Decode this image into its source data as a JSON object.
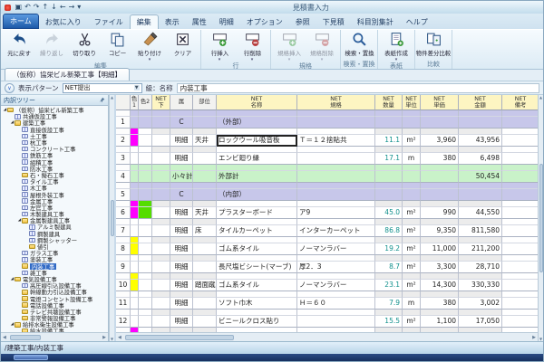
{
  "window": {
    "title": "見積書入力"
  },
  "quick_access": [
    "save",
    "undo",
    "redo",
    "up",
    "down",
    "left",
    "right",
    "menu"
  ],
  "ribbon": {
    "tabs": [
      {
        "label": "ホーム",
        "style": "home"
      },
      {
        "label": "お気に入り",
        "style": ""
      },
      {
        "label": "ファイル",
        "style": ""
      },
      {
        "label": "編集",
        "style": "active"
      },
      {
        "label": "表示",
        "style": ""
      },
      {
        "label": "属性",
        "style": ""
      },
      {
        "label": "明細",
        "style": ""
      },
      {
        "label": "オプション",
        "style": ""
      },
      {
        "label": "参照",
        "style": ""
      },
      {
        "label": "下見積",
        "style": ""
      },
      {
        "label": "科目別集計",
        "style": ""
      },
      {
        "label": "ヘルプ",
        "style": ""
      }
    ],
    "groups": [
      {
        "label": "編集",
        "buttons": [
          {
            "label": "元に戻す",
            "icon": "undo",
            "enabled": true,
            "menu": false
          },
          {
            "label": "繰り返し",
            "icon": "redo",
            "enabled": false,
            "menu": false
          },
          {
            "label": "切り取り",
            "icon": "cut",
            "enabled": true,
            "menu": false
          },
          {
            "label": "コピー",
            "icon": "copy",
            "enabled": true,
            "menu": false
          },
          {
            "label": "貼り付け",
            "icon": "paste",
            "enabled": true,
            "menu": true
          },
          {
            "label": "クリア",
            "icon": "clear",
            "enabled": true,
            "menu": false
          }
        ]
      },
      {
        "label": "行",
        "buttons": [
          {
            "label": "行挿入",
            "icon": "row-insert",
            "enabled": true,
            "menu": true
          },
          {
            "label": "行削除",
            "icon": "row-delete",
            "enabled": true,
            "menu": true
          }
        ]
      },
      {
        "label": "規格",
        "buttons": [
          {
            "label": "規格挿入",
            "icon": "row-insert",
            "enabled": false,
            "menu": true
          },
          {
            "label": "規格削除",
            "icon": "row-delete",
            "enabled": false,
            "menu": true
          }
        ]
      },
      {
        "label": "検索・置換",
        "buttons": [
          {
            "label": "検索・置換",
            "icon": "search",
            "enabled": true,
            "menu": false
          }
        ]
      },
      {
        "label": "表紙",
        "buttons": [
          {
            "label": "表紙作成",
            "icon": "cover",
            "enabled": true,
            "menu": true
          }
        ]
      },
      {
        "label": "比較",
        "buttons": [
          {
            "label": "物件差分比較",
            "icon": "compare",
            "enabled": true,
            "menu": false
          }
        ]
      }
    ]
  },
  "document_tab": "（仮称）協栄ビル新築工事【明細】",
  "pattern_bar": {
    "collapse_glyph": "∨",
    "label": "表示パターン",
    "value": "NET提出",
    "level_label": "級：名称",
    "level_value": "内装工事"
  },
  "tree": {
    "header": "内訳ツリー",
    "items": [
      {
        "label": "（仮称）協栄ビル新築工事",
        "depth": 0,
        "icon": "folder",
        "expanded": true,
        "selected": false
      },
      {
        "label": "共通仮設工事",
        "depth": 1,
        "icon": "sheet",
        "expanded": false,
        "selected": false
      },
      {
        "label": "建築工事",
        "depth": 1,
        "icon": "folder",
        "expanded": true,
        "selected": false
      },
      {
        "label": "直接仮設工事",
        "depth": 2,
        "icon": "sheet",
        "expanded": false,
        "selected": false
      },
      {
        "label": "土工事",
        "depth": 2,
        "icon": "sheet",
        "expanded": false,
        "selected": false
      },
      {
        "label": "杭工事",
        "depth": 2,
        "icon": "sheet",
        "expanded": false,
        "selected": false
      },
      {
        "label": "コンクリート工事",
        "depth": 2,
        "icon": "sheet",
        "expanded": false,
        "selected": false
      },
      {
        "label": "鉄筋工事",
        "depth": 2,
        "icon": "sheet",
        "expanded": false,
        "selected": false
      },
      {
        "label": "組積工事",
        "depth": 2,
        "icon": "sheet",
        "expanded": false,
        "selected": false
      },
      {
        "label": "防水工事",
        "depth": 2,
        "icon": "sheet",
        "expanded": false,
        "selected": false
      },
      {
        "label": "石・擬石工事",
        "depth": 2,
        "icon": "folder",
        "expanded": false,
        "selected": false
      },
      {
        "label": "タイル工事",
        "depth": 2,
        "icon": "sheet",
        "expanded": false,
        "selected": false
      },
      {
        "label": "木工事",
        "depth": 2,
        "icon": "sheet",
        "expanded": false,
        "selected": false
      },
      {
        "label": "屋根外装工事",
        "depth": 2,
        "icon": "sheet",
        "expanded": false,
        "selected": false
      },
      {
        "label": "金属工事",
        "depth": 2,
        "icon": "sheet",
        "expanded": false,
        "selected": false
      },
      {
        "label": "左官工事",
        "depth": 2,
        "icon": "sheet",
        "expanded": false,
        "selected": false
      },
      {
        "label": "木製建具工事",
        "depth": 2,
        "icon": "sheet",
        "expanded": false,
        "selected": false
      },
      {
        "label": "金属製建具工事",
        "depth": 2,
        "icon": "folder",
        "expanded": true,
        "selected": false
      },
      {
        "label": "アルミ製建具",
        "depth": 3,
        "icon": "sheet",
        "expanded": false,
        "selected": false
      },
      {
        "label": "鋼製建具",
        "depth": 3,
        "icon": "sheet",
        "expanded": false,
        "selected": false
      },
      {
        "label": "鋼製シャッター",
        "depth": 3,
        "icon": "sheet",
        "expanded": false,
        "selected": false
      },
      {
        "label": "値引",
        "depth": 3,
        "icon": "folder",
        "expanded": false,
        "selected": false
      },
      {
        "label": "ガラス工事",
        "depth": 2,
        "icon": "sheet",
        "expanded": false,
        "selected": false
      },
      {
        "label": "塗装工事",
        "depth": 2,
        "icon": "sheet",
        "expanded": false,
        "selected": false
      },
      {
        "label": "内装工事",
        "depth": 2,
        "icon": "folder",
        "expanded": false,
        "selected": true
      },
      {
        "label": "雑工事",
        "depth": 2,
        "icon": "sheet",
        "expanded": false,
        "selected": false
      },
      {
        "label": "電気設備工事",
        "depth": 1,
        "icon": "folder",
        "expanded": true,
        "selected": false
      },
      {
        "label": "高圧線引込設備工事",
        "depth": 2,
        "icon": "sheet",
        "expanded": false,
        "selected": false
      },
      {
        "label": "幹線動力引込設備工事",
        "depth": 2,
        "icon": "folder",
        "expanded": false,
        "selected": false
      },
      {
        "label": "電燈コンセント設備工事",
        "depth": 2,
        "icon": "folder",
        "expanded": false,
        "selected": false
      },
      {
        "label": "電話設備工事",
        "depth": 2,
        "icon": "folder",
        "expanded": false,
        "selected": false
      },
      {
        "label": "テレビ共聴設備工事",
        "depth": 2,
        "icon": "folder",
        "expanded": false,
        "selected": false
      },
      {
        "label": "非常警報設備工事",
        "depth": 2,
        "icon": "folder",
        "expanded": false,
        "selected": false
      },
      {
        "label": "給排水衛生設備工事",
        "depth": 1,
        "icon": "folder",
        "expanded": true,
        "selected": false
      },
      {
        "label": "給水設備工事",
        "depth": 2,
        "icon": "folder",
        "expanded": false,
        "selected": false
      }
    ]
  },
  "table": {
    "columns": [
      {
        "key": "num",
        "label": "",
        "width": 16,
        "hclass": "gray",
        "align": "ac"
      },
      {
        "key": "c1",
        "label": "色1",
        "width": 9,
        "hclass": "gray",
        "align": ""
      },
      {
        "key": "c2",
        "label": "色2",
        "width": 15,
        "hclass": "gray",
        "align": ""
      },
      {
        "key": "shita",
        "label": "NET\n下",
        "width": 20,
        "hclass": "yellow",
        "align": "ac"
      },
      {
        "key": "zoku",
        "label": "属",
        "width": 25,
        "hclass": "gray",
        "align": "ac"
      },
      {
        "key": "bui",
        "label": "部位",
        "width": 26,
        "hclass": "gray",
        "align": ""
      },
      {
        "key": "name",
        "label": "NET\n名称",
        "width": 89,
        "hclass": "yellow",
        "align": ""
      },
      {
        "key": "kikaku",
        "label": "NET\n規格",
        "width": 86,
        "hclass": "yellow",
        "align": ""
      },
      {
        "key": "qty",
        "label": "NET\n数量",
        "width": 30,
        "hclass": "yellow",
        "align": "qty"
      },
      {
        "key": "unit",
        "label": "NET\n単位",
        "width": 20,
        "hclass": "yellow",
        "align": "ac"
      },
      {
        "key": "price",
        "label": "NET\n単価",
        "width": 42,
        "hclass": "yellow",
        "align": "ar"
      },
      {
        "key": "amount",
        "label": "NET\n金額",
        "width": 48,
        "hclass": "yellow",
        "align": "ar"
      },
      {
        "key": "note",
        "label": "NET\n備考",
        "width": 41,
        "hclass": "yellow",
        "align": ""
      }
    ],
    "rows": [
      {
        "num": "1",
        "type": "category",
        "c1": "",
        "c2": "",
        "zoku": "C",
        "bui": "",
        "name": "（外部）",
        "kikaku": "",
        "qty": "",
        "unit": "",
        "price": "",
        "amount": "",
        "note": ""
      },
      {
        "num": "2",
        "type": "detail",
        "c1": "#ff00ff",
        "c2": "",
        "zoku": "明細",
        "bui": "天井",
        "name": "ロックウール吸音板",
        "kikaku": "Ｔ＝１２捨貼共",
        "qty": "11.1",
        "unit": "m²",
        "price": "3,960",
        "amount": "43,956",
        "note": "",
        "selected": "name"
      },
      {
        "num": "3",
        "type": "detail",
        "c1": "",
        "c2": "",
        "zoku": "明細",
        "bui": "",
        "name": "エンビ廻り縁",
        "kikaku": "",
        "qty": "17.1",
        "unit": "m",
        "price": "380",
        "amount": "6,498",
        "note": ""
      },
      {
        "num": "4",
        "type": "subtotal",
        "c1": "",
        "c2": "",
        "zoku": "小々計",
        "bui": "",
        "name": "外部計",
        "kikaku": "",
        "qty": "",
        "unit": "",
        "price": "",
        "amount": "50,454",
        "note": ""
      },
      {
        "num": "5",
        "type": "category",
        "c1": "",
        "c2": "",
        "zoku": "C",
        "bui": "",
        "name": "（内部）",
        "kikaku": "",
        "qty": "",
        "unit": "",
        "price": "",
        "amount": "",
        "note": ""
      },
      {
        "num": "6",
        "type": "detail",
        "c1": "#ff00ff",
        "c2": "#55dd00",
        "zoku": "明細",
        "bui": "天井",
        "name": "プラスターボード",
        "kikaku": "ア9",
        "qty": "45.0",
        "unit": "m²",
        "price": "990",
        "amount": "44,550",
        "note": ""
      },
      {
        "num": "7",
        "type": "detail",
        "c1": "",
        "c2": "",
        "zoku": "明細",
        "bui": "床",
        "name": "タイルカーペット",
        "kikaku": "インターカーペット",
        "qty": "86.8",
        "unit": "m²",
        "price": "9,350",
        "amount": "811,580",
        "note": ""
      },
      {
        "num": "8",
        "type": "detail",
        "c1": "#ffff00",
        "c2": "",
        "zoku": "明細",
        "bui": "",
        "name": "ゴム系タイル",
        "kikaku": "ノーマンラバー",
        "qty": "19.2",
        "unit": "m²",
        "price": "11,000",
        "amount": "211,200",
        "note": ""
      },
      {
        "num": "9",
        "type": "detail",
        "c1": "",
        "c2": "",
        "zoku": "明細",
        "bui": "",
        "name": "長尺塩ビシート(マーブ)",
        "kikaku": "厚2．3",
        "qty": "8.7",
        "unit": "m²",
        "price": "3,300",
        "amount": "28,710",
        "note": ""
      },
      {
        "num": "10",
        "type": "detail",
        "c1": "#ffff00",
        "c2": "",
        "zoku": "明細",
        "bui": "踏面蹴上",
        "name": "ゴム系タイル",
        "kikaku": "ノーマンラバー",
        "qty": "23.1",
        "unit": "m²",
        "price": "14,300",
        "amount": "330,330",
        "note": ""
      },
      {
        "num": "11",
        "type": "detail",
        "c1": "",
        "c2": "",
        "zoku": "明細",
        "bui": "",
        "name": "ソフト巾木",
        "kikaku": "Ｈ＝６０",
        "qty": "7.9",
        "unit": "m",
        "price": "380",
        "amount": "3,002",
        "note": ""
      },
      {
        "num": "12",
        "type": "detail",
        "c1": "",
        "c2": "",
        "zoku": "明細",
        "bui": "",
        "name": "ビニールクロス貼り",
        "kikaku": "",
        "qty": "15.5",
        "unit": "m²",
        "price": "1,100",
        "amount": "17,050",
        "note": ""
      },
      {
        "num": "",
        "type": "partial",
        "c1": "#ff00ff",
        "c2": "",
        "zoku": "",
        "bui": "",
        "name": "",
        "kikaku": "",
        "qty": "",
        "unit": "",
        "price": "",
        "amount": "",
        "note": ""
      }
    ]
  },
  "status_bar": {
    "path": "/建築工事/内装工事"
  },
  "colors": {
    "category_row": "#c7c7ea",
    "subtotal_row": "#c9f2c9",
    "strip_gray": "#ececec",
    "magenta": "#ff00ff",
    "lime": "#55dd00",
    "yellow": "#ffff00",
    "selection_blue": "#316ac5"
  }
}
